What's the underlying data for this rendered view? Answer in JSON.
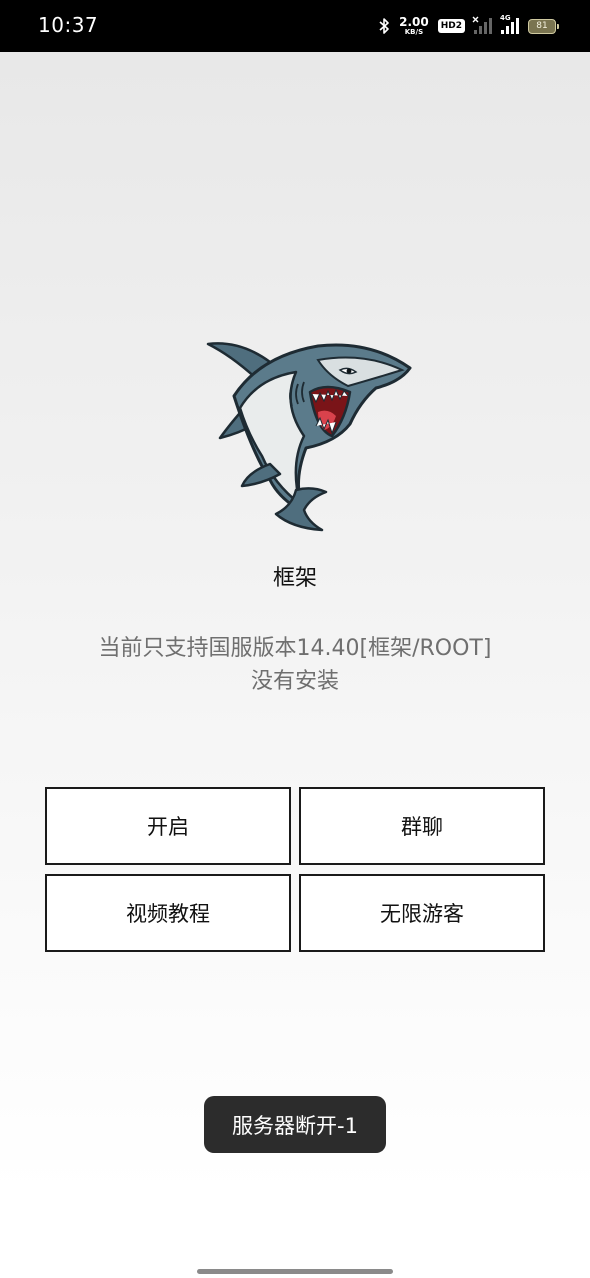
{
  "status_bar": {
    "time": "10:37",
    "bluetooth_icon": "bluetooth-icon",
    "net_speed": "2.00",
    "net_speed_unit": "KB/S",
    "hd_badge": "HD2",
    "signal_tag": "4G",
    "battery_level": "81"
  },
  "app": {
    "logo_icon": "shark-logo",
    "title": "框架",
    "status_line_1": "当前只支持国服版本14.40[框架/ROOT]",
    "status_line_2": "没有安装"
  },
  "buttons": {
    "start": "开启",
    "group_chat": "群聊",
    "video_tutorial": "视频教程",
    "unlimited_guest": "无限游客"
  },
  "toast": {
    "message": "服务器断开-1"
  },
  "colors": {
    "status_bar_bg": "#000000",
    "button_border": "#1a1a1a",
    "toast_bg": "#2c2c2c",
    "subtitle_text": "#6f6f6f"
  }
}
